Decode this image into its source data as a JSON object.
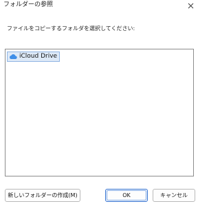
{
  "window": {
    "title": "フォルダーの参照"
  },
  "dialog": {
    "instruction": "ファイルをコピーするフォルダを選択してください:"
  },
  "tree": {
    "items": [
      {
        "label": "iCloud Drive",
        "icon": "cloud-icon",
        "selected": true
      }
    ]
  },
  "buttons": {
    "new_folder": "新しいフォルダーの作成(M)",
    "ok": "OK",
    "cancel": "キャンセル"
  },
  "colors": {
    "selection_bg": "#dde9f7",
    "selection_border": "#8fb4e3",
    "cloud": "#3f8ee8",
    "default_button_border": "#2f6fd1"
  }
}
